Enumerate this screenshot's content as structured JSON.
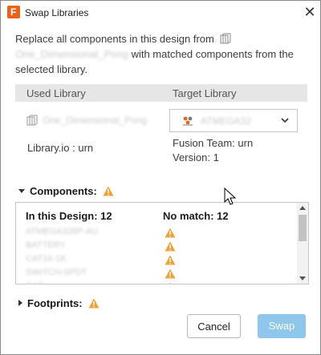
{
  "dialog": {
    "title": "Swap Libraries",
    "close_glyph": "✕"
  },
  "description": {
    "text_before": "Replace all components in this design from",
    "source_library": "One_Dimensional_Pong",
    "text_after_lib": "with matched components from the",
    "text_line3": "selected library."
  },
  "libraries": {
    "used_header": "Used Library",
    "target_header": "Target Library",
    "used_name": "One_Dimensional_Pong",
    "used_source": "Library.io : urn",
    "target_selected": "ATMEGA32",
    "target_source": "Fusion Team: urn",
    "target_version": "Version: 1"
  },
  "components": {
    "section_label": "Components:",
    "col_design": "In this Design: 12",
    "col_nomatch": "No match: 12",
    "rows": [
      "ATMEGA328P-AU",
      "BATTERY",
      "CAT16-1K",
      "SWITCH-SPDT",
      "CAP"
    ]
  },
  "footprints": {
    "section_label": "Footprints:"
  },
  "buttons": {
    "cancel": "Cancel",
    "swap": "Swap"
  },
  "colors": {
    "warning": "#f0a23a",
    "primary_disabled": "#8fc6ec",
    "header_bg": "#e6e6e6"
  }
}
